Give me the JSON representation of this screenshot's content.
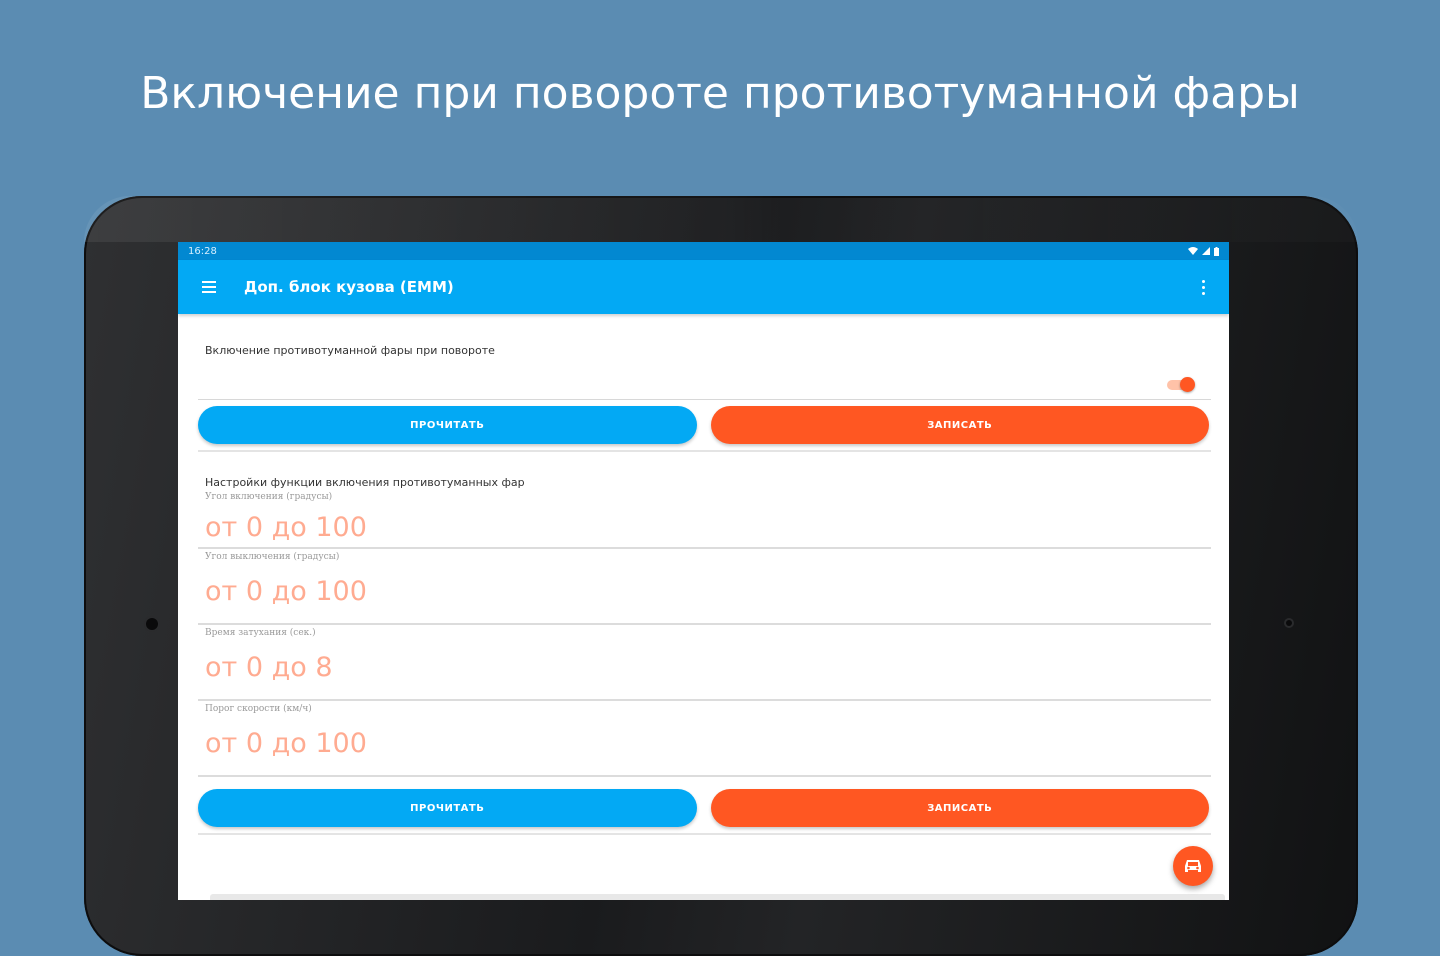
{
  "headline": "Включение при повороте противотуманной фары",
  "status_bar": {
    "time": "16:28"
  },
  "app_bar": {
    "title": "Доп. блок кузова (EMM)"
  },
  "toggle_card": {
    "title": "Включение противотуманной фары при повороте",
    "enabled": true
  },
  "buttons": {
    "read_label": "ПРОЧИТАТЬ",
    "write_label": "ЗАПИСАТЬ"
  },
  "settings": {
    "title": "Настройки функции включения противотуманных фар",
    "fields": [
      {
        "label": "Угол включения (градусы)",
        "hint": "от 0 до 100"
      },
      {
        "label": "Угол выключения (градусы)",
        "hint": "от 0 до 100"
      },
      {
        "label": "Время затухания (сек.)",
        "hint": "от 0 до 8"
      },
      {
        "label": "Порог скорости (км/ч)",
        "hint": "от 0 до 100"
      }
    ]
  },
  "icons": {
    "menu": "hamburger-menu-icon",
    "overflow": "more-vert-icon",
    "fab": "car-icon",
    "wifi": "wifi-icon",
    "signal": "signal-icon",
    "battery": "battery-icon"
  },
  "colors": {
    "background": "#5b8cb2",
    "primary": "#03a9f4",
    "primary_dark": "#0288d1",
    "accent": "#ff5722",
    "hint": "#ffab91"
  }
}
